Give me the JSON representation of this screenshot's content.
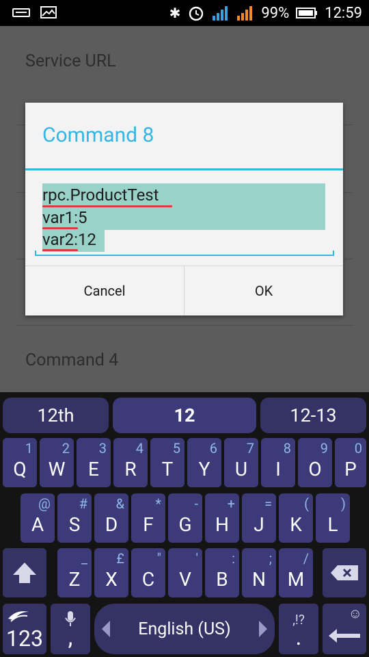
{
  "status": {
    "battery": "99%",
    "time": "12:59"
  },
  "background": {
    "row1": "Service URL",
    "row2": "Command 4"
  },
  "dialog": {
    "title": "Command 8",
    "lines": [
      "rpc.ProductTest",
      "var1:5",
      "var2:12"
    ],
    "cancel": "Cancel",
    "ok": "OK"
  },
  "keyboard": {
    "suggestions": [
      "12th",
      "12",
      "12-13"
    ],
    "row1": [
      [
        "Q",
        "1"
      ],
      [
        "W",
        "2"
      ],
      [
        "E",
        "3"
      ],
      [
        "R",
        "4"
      ],
      [
        "T",
        "5"
      ],
      [
        "Y",
        "6"
      ],
      [
        "U",
        "7"
      ],
      [
        "I",
        "8"
      ],
      [
        "O",
        "9"
      ],
      [
        "P",
        "0"
      ]
    ],
    "row2": [
      [
        "A",
        "@"
      ],
      [
        "S",
        "#"
      ],
      [
        "D",
        "&"
      ],
      [
        "F",
        "*"
      ],
      [
        "G",
        "-"
      ],
      [
        "H",
        "+"
      ],
      [
        "J",
        "="
      ],
      [
        "K",
        "("
      ],
      [
        "L",
        ")"
      ]
    ],
    "row3": [
      [
        "Z",
        "_"
      ],
      [
        "X",
        "£"
      ],
      [
        "C",
        "\""
      ],
      [
        "V",
        "'"
      ],
      [
        "B",
        ":"
      ],
      [
        "N",
        ";"
      ],
      [
        "M",
        "/"
      ]
    ],
    "numbers_label": "123",
    "comma": ",",
    "language": "English (US)",
    "period": ".",
    "punct_hint": ",!?"
  }
}
